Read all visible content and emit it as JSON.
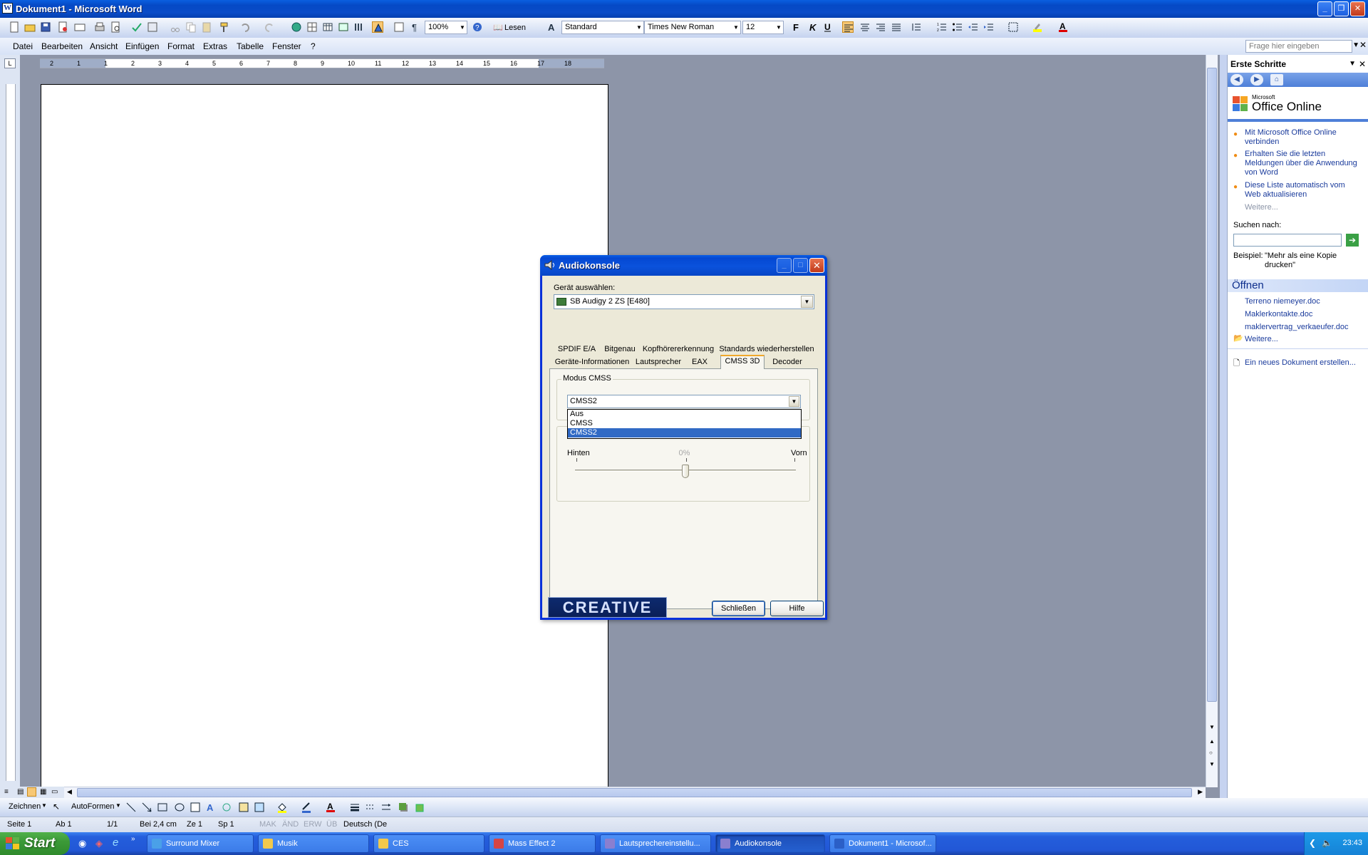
{
  "word": {
    "title": "Dokument1 - Microsoft Word",
    "zoom": "100%",
    "read_button": "Lesen",
    "style": "Standard",
    "font": "Times New Roman",
    "font_size": "12",
    "menu": [
      "Datei",
      "Bearbeiten",
      "Ansicht",
      "Einfügen",
      "Format",
      "Extras",
      "Tabelle",
      "Fenster",
      "?"
    ],
    "help_placeholder": "Frage hier eingeben",
    "ruler_numbers": [
      "2",
      "1",
      "1",
      "2",
      "3",
      "4",
      "5",
      "6",
      "7",
      "8",
      "9",
      "10",
      "11",
      "12",
      "13",
      "14",
      "15",
      "16",
      "17",
      "18"
    ]
  },
  "taskpane": {
    "title": "Erste Schritte",
    "logo_small": "Microsoft",
    "logo": "Office Online",
    "bullets": [
      "Mit Microsoft Office Online verbinden",
      "Erhalten Sie die letzten Meldungen über die Anwendung von Word",
      "Diese Liste automatisch vom Web aktualisieren"
    ],
    "more": "Weitere...",
    "search_label": "Suchen nach:",
    "example_label": "Beispiel:",
    "example_text": "\"Mehr als eine Kopie drucken\"",
    "open_title": "Öffnen",
    "files": [
      "Terreno niemeyer.doc",
      "Maklerkontakte.doc",
      "maklervertrag_verkaeufer.doc"
    ],
    "open_more": "Weitere...",
    "new_doc": "Ein neues Dokument erstellen..."
  },
  "drawbar": {
    "draw": "Zeichnen",
    "autoshapes": "AutoFormen"
  },
  "status": {
    "page": "Seite 1",
    "section": "Ab 1",
    "pages": "1/1",
    "at": "Bei 2,4 cm",
    "line": "Ze 1",
    "col": "Sp 1",
    "mak": "MAK",
    "and": "ÄND",
    "erw": "ERW",
    "ub": "ÜB",
    "lang": "Deutsch (De"
  },
  "taskbar": {
    "start": "Start",
    "tasks": [
      {
        "label": "Surround Mixer",
        "color": "#4aa0e8"
      },
      {
        "label": "Musik",
        "color": "#f2c94c"
      },
      {
        "label": "CES",
        "color": "#f2c94c"
      },
      {
        "label": "Mass Effect 2",
        "color": "#d64545"
      },
      {
        "label": "Lautsprechereinstellu...",
        "color": "#8a7fcf"
      },
      {
        "label": "Audiokonsole",
        "color": "#8a7fcf"
      },
      {
        "label": "Dokument1 - Microsof...",
        "color": "#2b5fc7"
      }
    ],
    "clock": "23:43"
  },
  "dialog": {
    "title": "Audiokonsole",
    "device_label": "Gerät auswählen:",
    "device": "SB Audigy 2 ZS [E480]",
    "tabs_row1": [
      "SPDIF E/A",
      "Bitgenau",
      "Kopfhörererkennung",
      "Standards wiederherstellen"
    ],
    "tabs_row2": [
      "Geräte-Informationen",
      "Lautsprecher",
      "EAX",
      "CMSS 3D",
      "Decoder"
    ],
    "group_label": "Modus CMSS",
    "cmss_value": "CMSS2",
    "cmss_options": [
      "Aus",
      "CMSS",
      "CMSS2"
    ],
    "slider_left": "Hinten",
    "slider_right": "Vorn",
    "slider_value": "0%",
    "slider_level": 0.5,
    "logo": "CREATIVE",
    "close_button": "Schließen",
    "help_button": "Hilfe"
  }
}
